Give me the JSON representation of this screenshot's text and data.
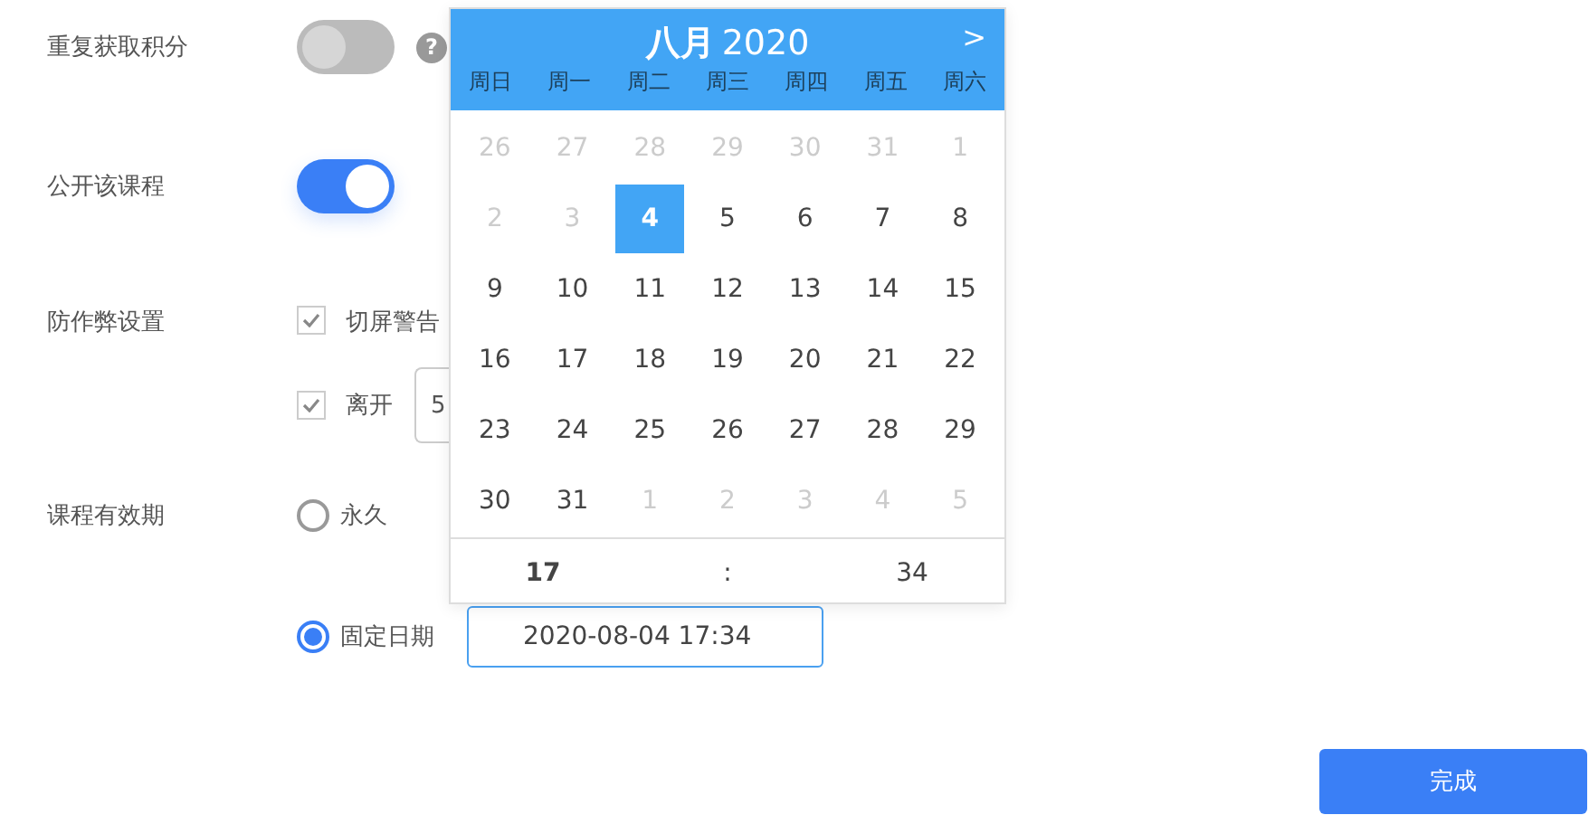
{
  "form": {
    "repeat_points": {
      "label": "重复获取积分",
      "on": false,
      "help": "?"
    },
    "public_course": {
      "label": "公开该课程",
      "on": true
    },
    "anti_cheat": {
      "label": "防作弊设置",
      "options": [
        {
          "label": "切屏警告",
          "checked": true
        },
        {
          "label": "离开",
          "checked": true,
          "value": "5"
        }
      ]
    },
    "validity": {
      "label": "课程有效期",
      "options": [
        {
          "label": "永久",
          "selected": false
        },
        {
          "label": "固定日期",
          "selected": true,
          "value": "2020-08-04 17:34"
        }
      ]
    }
  },
  "date_picker": {
    "month": "八月",
    "year": "2020",
    "next": ">",
    "weekdays": [
      "周日",
      "周一",
      "周二",
      "周三",
      "周四",
      "周五",
      "周六"
    ],
    "days": [
      {
        "label": "26",
        "kind": "other",
        "selected": false
      },
      {
        "label": "27",
        "kind": "other",
        "selected": false
      },
      {
        "label": "28",
        "kind": "other",
        "selected": false
      },
      {
        "label": "29",
        "kind": "other",
        "selected": false
      },
      {
        "label": "30",
        "kind": "other",
        "selected": false
      },
      {
        "label": "31",
        "kind": "other",
        "selected": false
      },
      {
        "label": "1",
        "kind": "other",
        "selected": false
      },
      {
        "label": "2",
        "kind": "other",
        "selected": false
      },
      {
        "label": "3",
        "kind": "other",
        "selected": false
      },
      {
        "label": "4",
        "kind": "current",
        "selected": true
      },
      {
        "label": "5",
        "kind": "current",
        "selected": false
      },
      {
        "label": "6",
        "kind": "current",
        "selected": false
      },
      {
        "label": "7",
        "kind": "current",
        "selected": false
      },
      {
        "label": "8",
        "kind": "current",
        "selected": false
      },
      {
        "label": "9",
        "kind": "current",
        "selected": false
      },
      {
        "label": "10",
        "kind": "current",
        "selected": false
      },
      {
        "label": "11",
        "kind": "current",
        "selected": false
      },
      {
        "label": "12",
        "kind": "current",
        "selected": false
      },
      {
        "label": "13",
        "kind": "current",
        "selected": false
      },
      {
        "label": "14",
        "kind": "current",
        "selected": false
      },
      {
        "label": "15",
        "kind": "current",
        "selected": false
      },
      {
        "label": "16",
        "kind": "current",
        "selected": false
      },
      {
        "label": "17",
        "kind": "current",
        "selected": false
      },
      {
        "label": "18",
        "kind": "current",
        "selected": false
      },
      {
        "label": "19",
        "kind": "current",
        "selected": false
      },
      {
        "label": "20",
        "kind": "current",
        "selected": false
      },
      {
        "label": "21",
        "kind": "current",
        "selected": false
      },
      {
        "label": "22",
        "kind": "current",
        "selected": false
      },
      {
        "label": "23",
        "kind": "current",
        "selected": false
      },
      {
        "label": "24",
        "kind": "current",
        "selected": false
      },
      {
        "label": "25",
        "kind": "current",
        "selected": false
      },
      {
        "label": "26",
        "kind": "current",
        "selected": false
      },
      {
        "label": "27",
        "kind": "current",
        "selected": false
      },
      {
        "label": "28",
        "kind": "current",
        "selected": false
      },
      {
        "label": "29",
        "kind": "current",
        "selected": false
      },
      {
        "label": "30",
        "kind": "current",
        "selected": false
      },
      {
        "label": "31",
        "kind": "current",
        "selected": false
      },
      {
        "label": "1",
        "kind": "other",
        "selected": false
      },
      {
        "label": "2",
        "kind": "other",
        "selected": false
      },
      {
        "label": "3",
        "kind": "other",
        "selected": false
      },
      {
        "label": "4",
        "kind": "other",
        "selected": false
      },
      {
        "label": "5",
        "kind": "other",
        "selected": false
      }
    ],
    "time": {
      "hour": "17",
      "separator": ":",
      "minute": "34"
    }
  },
  "done_button": "完成"
}
